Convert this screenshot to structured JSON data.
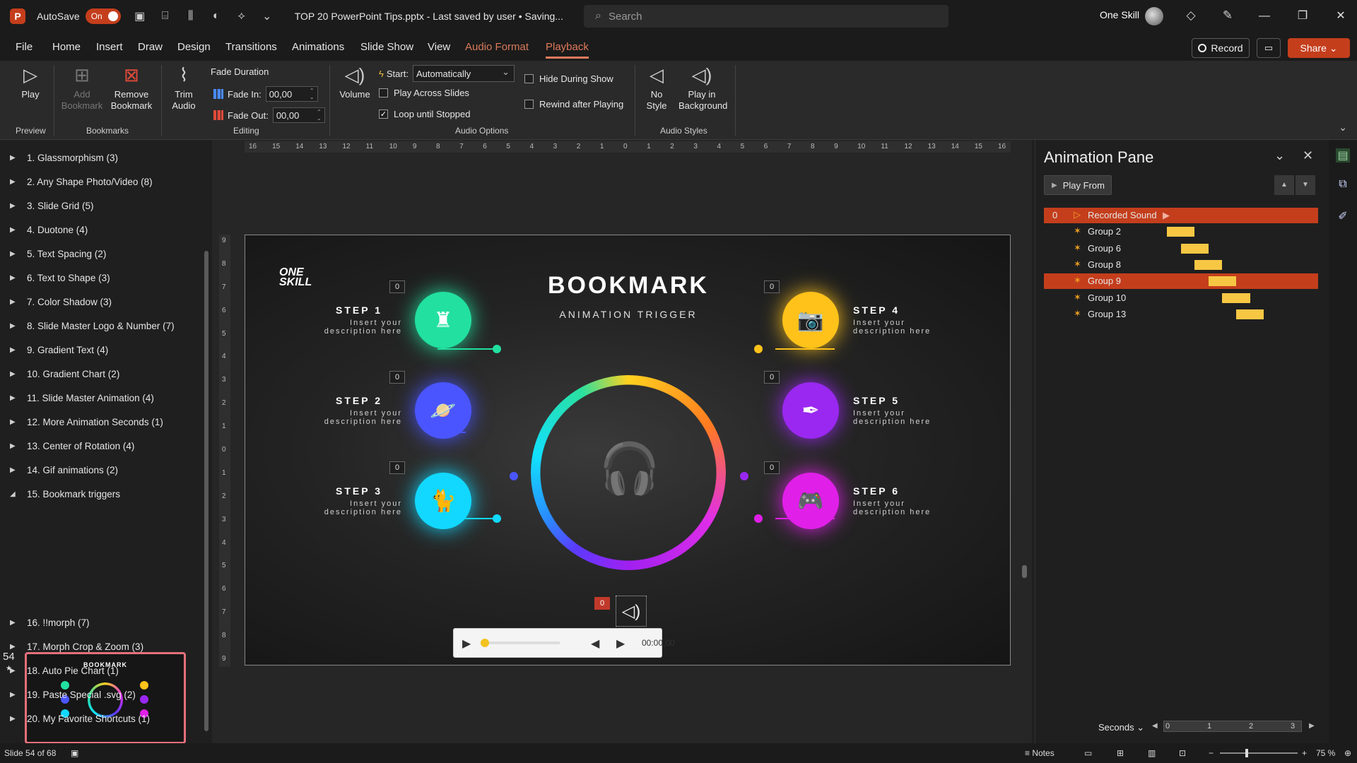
{
  "titlebar": {
    "autosave_label": "AutoSave",
    "autosave_state": "On",
    "document_title": "TOP 20 PowerPoint Tips.pptx  -  Last saved by user  •  Saving...",
    "search_placeholder": "Search",
    "account_name": "One Skill"
  },
  "menu": {
    "tabs": [
      "File",
      "Home",
      "Insert",
      "Draw",
      "Design",
      "Transitions",
      "Animations",
      "Slide Show",
      "View",
      "Audio Format",
      "Playback"
    ],
    "active_tab": "Playback",
    "record_label": "Record",
    "share_label": "Share"
  },
  "ribbon": {
    "preview": {
      "play_label": "Play",
      "group_label": "Preview"
    },
    "bookmarks": {
      "add_label": "Add Bookmark",
      "remove_label": "Remove Bookmark",
      "group_label": "Bookmarks"
    },
    "editing": {
      "trim_label": "Trim Audio",
      "fade_duration_label": "Fade Duration",
      "fade_in_label": "Fade In:",
      "fade_in_value": "00,00",
      "fade_out_label": "Fade Out:",
      "fade_out_value": "00,00",
      "group_label": "Editing"
    },
    "audio_options": {
      "volume_label": "Volume",
      "start_label": "Start:",
      "start_value": "Automatically",
      "play_across_slides_label": "Play Across Slides",
      "play_across_slides": false,
      "loop_label": "Loop until Stopped",
      "loop": true,
      "hide_label": "Hide During Show",
      "hide": false,
      "rewind_label": "Rewind after Playing",
      "rewind": false,
      "group_label": "Audio Options"
    },
    "audio_styles": {
      "no_style_label": "No Style",
      "play_bg_label": "Play in Background",
      "group_label": "Audio Styles"
    }
  },
  "outline": {
    "sections": [
      "1. Glassmorphism (3)",
      "2. Any Shape Photo/Video (8)",
      "3. Slide Grid (5)",
      "4. Duotone (4)",
      "5. Text Spacing (2)",
      "6. Text to Shape (3)",
      "7. Color Shadow (3)",
      "8. Slide Master Logo & Number (7)",
      "9. Gradient Text (4)",
      "10. Gradient Chart (2)",
      "11. Slide Master Animation (4)",
      "12. More Animation Seconds (1)",
      "13. Center of Rotation (4)",
      "14. Gif animations (2)",
      "15. Bookmark triggers"
    ],
    "sections_after": [
      "16. !!morph (7)",
      "17. Morph Crop & Zoom (3)",
      "18. Auto Pie Chart (1)",
      "19. Paste Special .svg (2)",
      "20. My Favorite Shortcuts (1)"
    ],
    "current_slide_number": "54",
    "thumb_title": "BOOKMARK"
  },
  "ruler": {
    "h": [
      "16",
      "15",
      "14",
      "13",
      "12",
      "11",
      "10",
      "9",
      "8",
      "7",
      "6",
      "5",
      "4",
      "3",
      "2",
      "1",
      "0",
      "1",
      "2",
      "3",
      "4",
      "5",
      "6",
      "7",
      "8",
      "9",
      "10",
      "11",
      "12",
      "13",
      "14",
      "15",
      "16"
    ],
    "v": [
      "9",
      "8",
      "7",
      "6",
      "5",
      "4",
      "3",
      "2",
      "1",
      "0",
      "1",
      "2",
      "3",
      "4",
      "5",
      "6",
      "7",
      "8",
      "9"
    ]
  },
  "slide": {
    "logo": "ONE\nSKILL",
    "title": "BOOKMARK",
    "subtitle": "ANIMATION TRIGGER",
    "steps": [
      {
        "label": "STEP 1",
        "desc": "Insert your\ndescription here",
        "trigger": "0",
        "color": "#22e0a0"
      },
      {
        "label": "STEP 2",
        "desc": "Insert your\ndescription here",
        "trigger": "0",
        "color": "#4a55ff"
      },
      {
        "label": "STEP 3",
        "desc": "Insert your\ndescription here",
        "trigger": "0",
        "color": "#12d8ff"
      },
      {
        "label": "STEP 4",
        "desc": "Insert your\ndescription here",
        "trigger": "0",
        "color": "#ffc21a"
      },
      {
        "label": "STEP 5",
        "desc": "Insert your\ndescription here",
        "trigger": "0",
        "color": "#9a28f0"
      },
      {
        "label": "STEP 6",
        "desc": "Insert your\ndescription here",
        "trigger": "0",
        "color": "#e020e8"
      }
    ],
    "audio_trigger": "0",
    "player_time": "00:00,00"
  },
  "animation_pane": {
    "title": "Animation Pane",
    "play_from_label": "Play From",
    "rows": [
      {
        "num": "0",
        "name": "Recorded Sound",
        "selected": true,
        "sound": true
      },
      {
        "num": "",
        "name": "Group 2",
        "selected": false,
        "start": 0.0,
        "length": 0.8
      },
      {
        "num": "",
        "name": "Group 6",
        "selected": false,
        "start": 0.4,
        "length": 0.8
      },
      {
        "num": "",
        "name": "Group 8",
        "selected": false,
        "start": 0.8,
        "length": 0.8
      },
      {
        "num": "",
        "name": "Group 9",
        "selected": true,
        "start": 1.2,
        "length": 0.8
      },
      {
        "num": "",
        "name": "Group 10",
        "selected": false,
        "start": 1.6,
        "length": 0.8
      },
      {
        "num": "",
        "name": "Group 13",
        "selected": false,
        "start": 2.0,
        "length": 0.8
      }
    ],
    "seconds_label": "Seconds",
    "timeline_ticks": [
      "0",
      "1",
      "2",
      "3"
    ]
  },
  "status": {
    "slide_info": "Slide 54 of 68",
    "notes_label": "Notes",
    "zoom": "75 %"
  },
  "colors": {
    "accent": "#c43e1c",
    "playback_tab": "#e07a5a",
    "anim_bar": "#f7c744"
  }
}
